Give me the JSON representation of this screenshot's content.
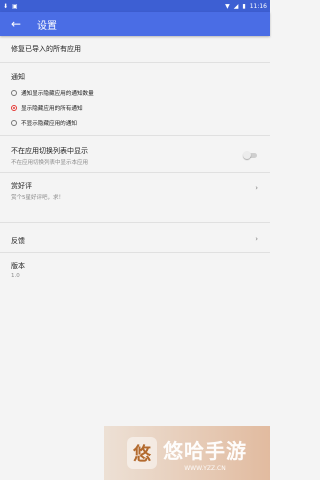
{
  "status_bar": {
    "left_icons": [
      "download-icon",
      "image-icon"
    ],
    "time": "11:16"
  },
  "app_bar": {
    "back_glyph": "←",
    "title": "设置"
  },
  "settings": {
    "repair_label": "修复已导入的所有应用",
    "notify": {
      "title": "通知",
      "options": [
        {
          "label": "通知显示隐藏应用的通知数量",
          "checked": false
        },
        {
          "label": "显示隐藏应用的所有通知",
          "checked": true
        },
        {
          "label": "不显示隐藏应用的通知",
          "checked": false
        }
      ]
    },
    "app_switch": {
      "title": "不在应用切换列表中显示",
      "subtitle": "不在应用切换列表中显示本应用",
      "enabled": false
    },
    "rate": {
      "title": "赏好评",
      "subtitle": "赏个5星好评吧，求！"
    },
    "feedback": {
      "title": "反馈"
    },
    "version": {
      "title": "版本",
      "value": "1.0"
    }
  },
  "watermark": {
    "logo_char": "悠",
    "brand": "悠哈手游",
    "url": "WWW.YZZ.CN"
  }
}
